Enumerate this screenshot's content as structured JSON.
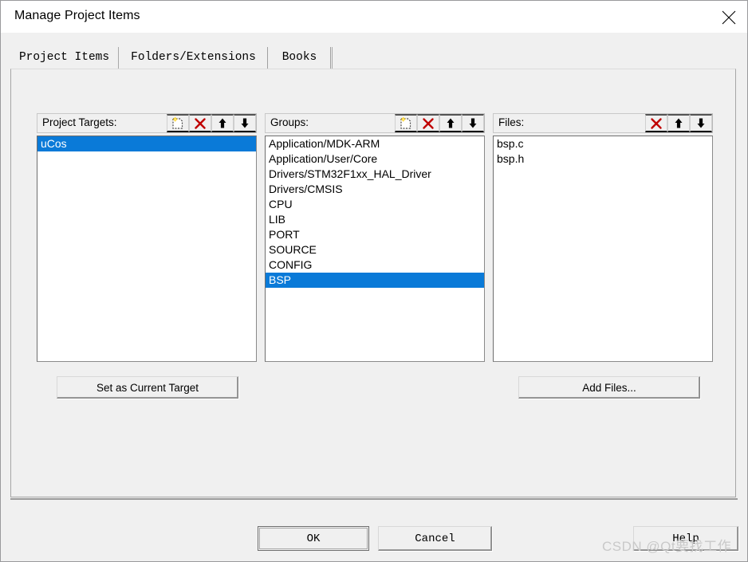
{
  "window": {
    "title": "Manage Project Items",
    "close_icon": "close-icon"
  },
  "tabs": [
    {
      "label": "Project Items",
      "active": true
    },
    {
      "label": "Folders/Extensions",
      "active": false
    },
    {
      "label": "Books",
      "active": false
    }
  ],
  "panels": {
    "targets": {
      "label": "Project Targets:",
      "tools": [
        {
          "name": "new-item-icon",
          "title": "New"
        },
        {
          "name": "delete-item-icon",
          "title": "Remove"
        },
        {
          "name": "move-up-icon",
          "title": "Move Up"
        },
        {
          "name": "move-down-icon",
          "title": "Move Down"
        }
      ],
      "items": [
        {
          "text": "uCos",
          "selected": true
        }
      ],
      "action_button": "Set as Current Target"
    },
    "groups": {
      "label": "Groups:",
      "tools": [
        {
          "name": "new-item-icon",
          "title": "New"
        },
        {
          "name": "delete-item-icon",
          "title": "Remove"
        },
        {
          "name": "move-up-icon",
          "title": "Move Up"
        },
        {
          "name": "move-down-icon",
          "title": "Move Down"
        }
      ],
      "items": [
        {
          "text": "Application/MDK-ARM",
          "selected": false
        },
        {
          "text": "Application/User/Core",
          "selected": false
        },
        {
          "text": "Drivers/STM32F1xx_HAL_Driver",
          "selected": false
        },
        {
          "text": "Drivers/CMSIS",
          "selected": false
        },
        {
          "text": "CPU",
          "selected": false
        },
        {
          "text": "LIB",
          "selected": false
        },
        {
          "text": "PORT",
          "selected": false
        },
        {
          "text": "SOURCE",
          "selected": false
        },
        {
          "text": "CONFIG",
          "selected": false
        },
        {
          "text": "BSP",
          "selected": true
        }
      ]
    },
    "files": {
      "label": "Files:",
      "tools": [
        {
          "name": "delete-item-icon",
          "title": "Remove"
        },
        {
          "name": "move-up-icon",
          "title": "Move Up"
        },
        {
          "name": "move-down-icon",
          "title": "Move Down"
        }
      ],
      "items": [
        {
          "text": "bsp.c",
          "selected": false
        },
        {
          "text": "bsp.h",
          "selected": false
        }
      ],
      "action_button": "Add Files..."
    }
  },
  "footer": {
    "ok": "OK",
    "cancel": "Cancel",
    "help": "Help"
  },
  "watermark": "CSDN @Qt要找工作",
  "colors": {
    "selection": "#0a7ad8",
    "dialog_bg": "#f0f0f0",
    "delete_icon": "#c00000",
    "new_icon_accent": "#ffd21e"
  }
}
